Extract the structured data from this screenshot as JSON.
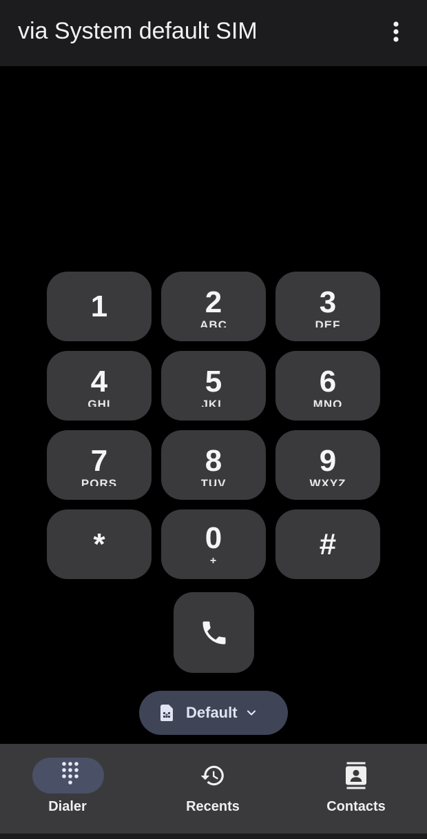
{
  "header": {
    "title": "via System default SIM",
    "more_icon": "more-vert-icon"
  },
  "keypad": {
    "keys": [
      {
        "digit": "1",
        "letters": ""
      },
      {
        "digit": "2",
        "letters": "ABC"
      },
      {
        "digit": "3",
        "letters": "DEF"
      },
      {
        "digit": "4",
        "letters": "GHI"
      },
      {
        "digit": "5",
        "letters": "JKL"
      },
      {
        "digit": "6",
        "letters": "MNO"
      },
      {
        "digit": "7",
        "letters": "PQRS"
      },
      {
        "digit": "8",
        "letters": "TUV"
      },
      {
        "digit": "9",
        "letters": "WXYZ"
      },
      {
        "digit": "*",
        "letters": ""
      },
      {
        "digit": "0",
        "letters": "+"
      },
      {
        "digit": "#",
        "letters": ""
      }
    ],
    "call_icon": "phone-icon"
  },
  "sim_selector": {
    "label": "Default",
    "icon": "sim-card-icon",
    "chevron": "chevron-down-icon"
  },
  "bottom_nav": {
    "items": [
      {
        "label": "Dialer",
        "icon": "dialpad-icon",
        "active": true
      },
      {
        "label": "Recents",
        "icon": "history-icon",
        "active": false
      },
      {
        "label": "Contacts",
        "icon": "contacts-icon",
        "active": false
      }
    ]
  },
  "colors": {
    "background": "#000000",
    "key_fill": "#3a3a3c",
    "chip_fill": "#3f4456",
    "active_pill": "#4a5066"
  }
}
